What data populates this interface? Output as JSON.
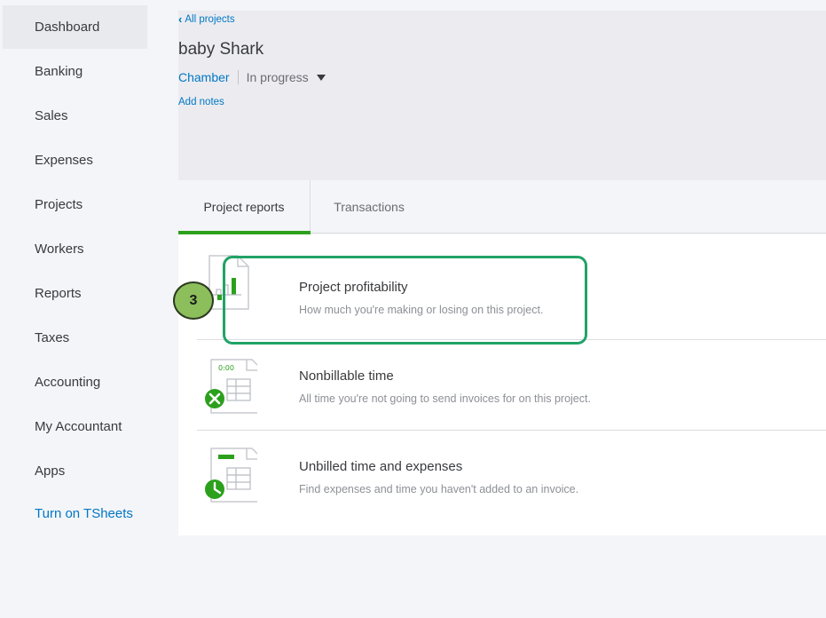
{
  "sidebar": {
    "items": [
      {
        "label": "Dashboard"
      },
      {
        "label": "Banking"
      },
      {
        "label": "Sales"
      },
      {
        "label": "Expenses"
      },
      {
        "label": "Projects"
      },
      {
        "label": "Workers"
      },
      {
        "label": "Reports"
      },
      {
        "label": "Taxes"
      },
      {
        "label": "Accounting"
      },
      {
        "label": "My Accountant"
      },
      {
        "label": "Apps"
      }
    ],
    "tsheets_label": "Turn on TSheets"
  },
  "header": {
    "back_label": "All projects",
    "project_name": "baby Shark",
    "customer": "Chamber",
    "status": "In progress",
    "add_notes_label": "Add notes"
  },
  "tabs": [
    {
      "label": "Project reports"
    },
    {
      "label": "Transactions"
    }
  ],
  "reports": [
    {
      "title": "Project profitability",
      "description": "How much you're making or losing on this project."
    },
    {
      "title": "Nonbillable time",
      "description": "All time you're not going to send invoices for on this project.",
      "icon_text": "0:00"
    },
    {
      "title": "Unbilled time and expenses",
      "description": "Find expenses and time you haven't added to an invoice."
    }
  ],
  "annotation": {
    "step_number": "3"
  },
  "colors": {
    "accent_green": "#2ca01c",
    "link_blue": "#0077c5",
    "highlight": "#21a366"
  }
}
